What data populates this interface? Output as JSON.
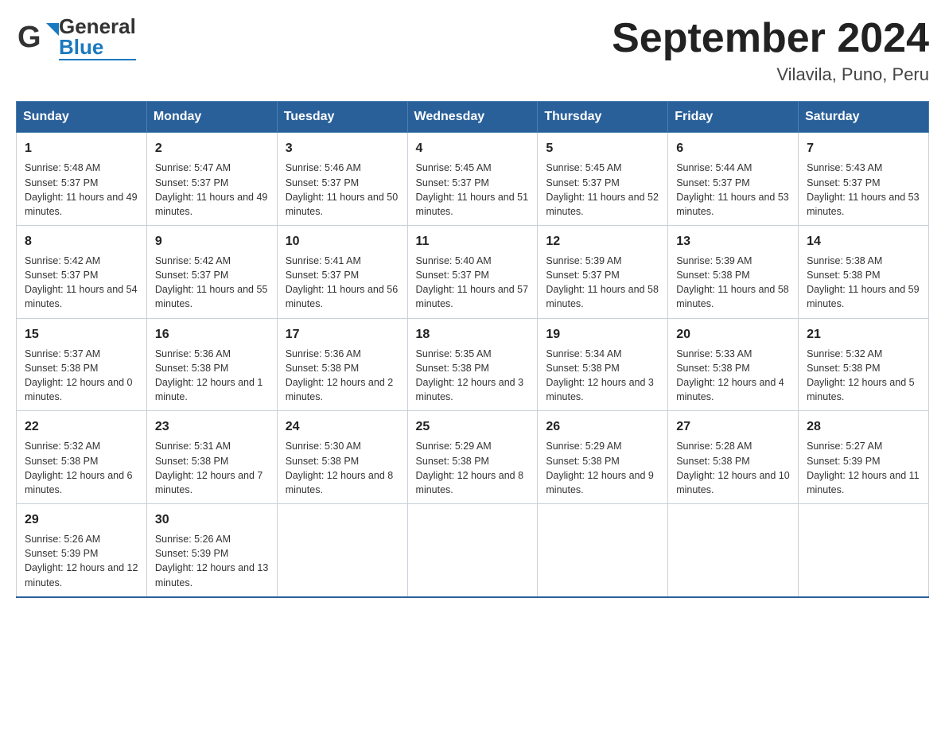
{
  "logo": {
    "general": "General",
    "blue": "Blue"
  },
  "title": "September 2024",
  "subtitle": "Vilavila, Puno, Peru",
  "days_of_week": [
    "Sunday",
    "Monday",
    "Tuesday",
    "Wednesday",
    "Thursday",
    "Friday",
    "Saturday"
  ],
  "weeks": [
    [
      {
        "day": "1",
        "sunrise": "Sunrise: 5:48 AM",
        "sunset": "Sunset: 5:37 PM",
        "daylight": "Daylight: 11 hours and 49 minutes."
      },
      {
        "day": "2",
        "sunrise": "Sunrise: 5:47 AM",
        "sunset": "Sunset: 5:37 PM",
        "daylight": "Daylight: 11 hours and 49 minutes."
      },
      {
        "day": "3",
        "sunrise": "Sunrise: 5:46 AM",
        "sunset": "Sunset: 5:37 PM",
        "daylight": "Daylight: 11 hours and 50 minutes."
      },
      {
        "day": "4",
        "sunrise": "Sunrise: 5:45 AM",
        "sunset": "Sunset: 5:37 PM",
        "daylight": "Daylight: 11 hours and 51 minutes."
      },
      {
        "day": "5",
        "sunrise": "Sunrise: 5:45 AM",
        "sunset": "Sunset: 5:37 PM",
        "daylight": "Daylight: 11 hours and 52 minutes."
      },
      {
        "day": "6",
        "sunrise": "Sunrise: 5:44 AM",
        "sunset": "Sunset: 5:37 PM",
        "daylight": "Daylight: 11 hours and 53 minutes."
      },
      {
        "day": "7",
        "sunrise": "Sunrise: 5:43 AM",
        "sunset": "Sunset: 5:37 PM",
        "daylight": "Daylight: 11 hours and 53 minutes."
      }
    ],
    [
      {
        "day": "8",
        "sunrise": "Sunrise: 5:42 AM",
        "sunset": "Sunset: 5:37 PM",
        "daylight": "Daylight: 11 hours and 54 minutes."
      },
      {
        "day": "9",
        "sunrise": "Sunrise: 5:42 AM",
        "sunset": "Sunset: 5:37 PM",
        "daylight": "Daylight: 11 hours and 55 minutes."
      },
      {
        "day": "10",
        "sunrise": "Sunrise: 5:41 AM",
        "sunset": "Sunset: 5:37 PM",
        "daylight": "Daylight: 11 hours and 56 minutes."
      },
      {
        "day": "11",
        "sunrise": "Sunrise: 5:40 AM",
        "sunset": "Sunset: 5:37 PM",
        "daylight": "Daylight: 11 hours and 57 minutes."
      },
      {
        "day": "12",
        "sunrise": "Sunrise: 5:39 AM",
        "sunset": "Sunset: 5:37 PM",
        "daylight": "Daylight: 11 hours and 58 minutes."
      },
      {
        "day": "13",
        "sunrise": "Sunrise: 5:39 AM",
        "sunset": "Sunset: 5:38 PM",
        "daylight": "Daylight: 11 hours and 58 minutes."
      },
      {
        "day": "14",
        "sunrise": "Sunrise: 5:38 AM",
        "sunset": "Sunset: 5:38 PM",
        "daylight": "Daylight: 11 hours and 59 minutes."
      }
    ],
    [
      {
        "day": "15",
        "sunrise": "Sunrise: 5:37 AM",
        "sunset": "Sunset: 5:38 PM",
        "daylight": "Daylight: 12 hours and 0 minutes."
      },
      {
        "day": "16",
        "sunrise": "Sunrise: 5:36 AM",
        "sunset": "Sunset: 5:38 PM",
        "daylight": "Daylight: 12 hours and 1 minute."
      },
      {
        "day": "17",
        "sunrise": "Sunrise: 5:36 AM",
        "sunset": "Sunset: 5:38 PM",
        "daylight": "Daylight: 12 hours and 2 minutes."
      },
      {
        "day": "18",
        "sunrise": "Sunrise: 5:35 AM",
        "sunset": "Sunset: 5:38 PM",
        "daylight": "Daylight: 12 hours and 3 minutes."
      },
      {
        "day": "19",
        "sunrise": "Sunrise: 5:34 AM",
        "sunset": "Sunset: 5:38 PM",
        "daylight": "Daylight: 12 hours and 3 minutes."
      },
      {
        "day": "20",
        "sunrise": "Sunrise: 5:33 AM",
        "sunset": "Sunset: 5:38 PM",
        "daylight": "Daylight: 12 hours and 4 minutes."
      },
      {
        "day": "21",
        "sunrise": "Sunrise: 5:32 AM",
        "sunset": "Sunset: 5:38 PM",
        "daylight": "Daylight: 12 hours and 5 minutes."
      }
    ],
    [
      {
        "day": "22",
        "sunrise": "Sunrise: 5:32 AM",
        "sunset": "Sunset: 5:38 PM",
        "daylight": "Daylight: 12 hours and 6 minutes."
      },
      {
        "day": "23",
        "sunrise": "Sunrise: 5:31 AM",
        "sunset": "Sunset: 5:38 PM",
        "daylight": "Daylight: 12 hours and 7 minutes."
      },
      {
        "day": "24",
        "sunrise": "Sunrise: 5:30 AM",
        "sunset": "Sunset: 5:38 PM",
        "daylight": "Daylight: 12 hours and 8 minutes."
      },
      {
        "day": "25",
        "sunrise": "Sunrise: 5:29 AM",
        "sunset": "Sunset: 5:38 PM",
        "daylight": "Daylight: 12 hours and 8 minutes."
      },
      {
        "day": "26",
        "sunrise": "Sunrise: 5:29 AM",
        "sunset": "Sunset: 5:38 PM",
        "daylight": "Daylight: 12 hours and 9 minutes."
      },
      {
        "day": "27",
        "sunrise": "Sunrise: 5:28 AM",
        "sunset": "Sunset: 5:38 PM",
        "daylight": "Daylight: 12 hours and 10 minutes."
      },
      {
        "day": "28",
        "sunrise": "Sunrise: 5:27 AM",
        "sunset": "Sunset: 5:39 PM",
        "daylight": "Daylight: 12 hours and 11 minutes."
      }
    ],
    [
      {
        "day": "29",
        "sunrise": "Sunrise: 5:26 AM",
        "sunset": "Sunset: 5:39 PM",
        "daylight": "Daylight: 12 hours and 12 minutes."
      },
      {
        "day": "30",
        "sunrise": "Sunrise: 5:26 AM",
        "sunset": "Sunset: 5:39 PM",
        "daylight": "Daylight: 12 hours and 13 minutes."
      },
      null,
      null,
      null,
      null,
      null
    ]
  ]
}
